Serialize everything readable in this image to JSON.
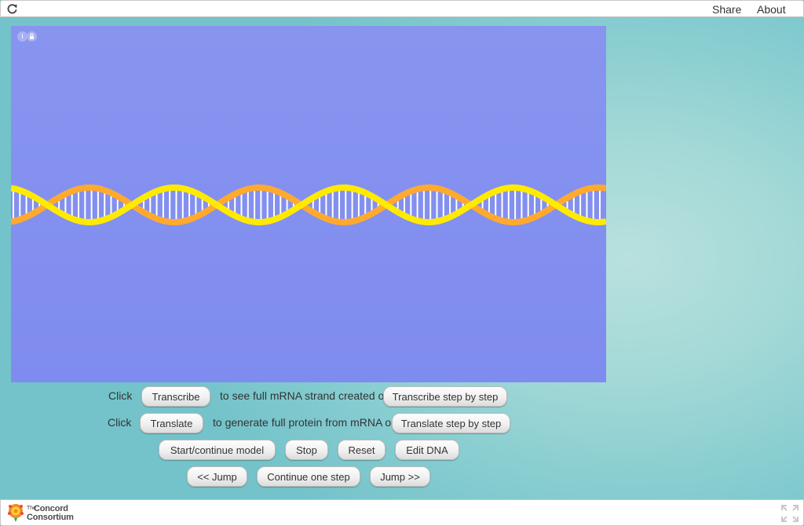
{
  "topbar": {
    "reload_icon": "reload-icon",
    "share_label": "Share",
    "about_label": "About"
  },
  "model": {
    "background_color": "#8390ef",
    "info_icon": "i",
    "lock_icon": "lock-icon",
    "helix_colors": {
      "strand_front": "#ffea00",
      "strand_back": "#ffaa2e",
      "base_pairs": "#ffffff"
    }
  },
  "controls": {
    "row1": {
      "prefix": "Click",
      "transcribe_label": "Transcribe",
      "middle": "to see full mRNA strand created or",
      "transcribe_step_label": "Transcribe step by step"
    },
    "row2": {
      "prefix": "Click",
      "translate_label": "Translate",
      "middle": "to generate full protein from mRNA or",
      "translate_step_label": "Translate step by step"
    },
    "row3": {
      "start_label": "Start/continue model",
      "stop_label": "Stop",
      "reset_label": "Reset",
      "edit_dna_label": "Edit DNA"
    },
    "row4": {
      "jump_back_label": "<< Jump",
      "continue_label": "Continue one step",
      "jump_forward_label": "Jump >>"
    }
  },
  "footer": {
    "logo_line1": "The",
    "logo_line2": "Concord",
    "logo_line3": "Consortium",
    "fullscreen_icon": "fullscreen-icon"
  }
}
